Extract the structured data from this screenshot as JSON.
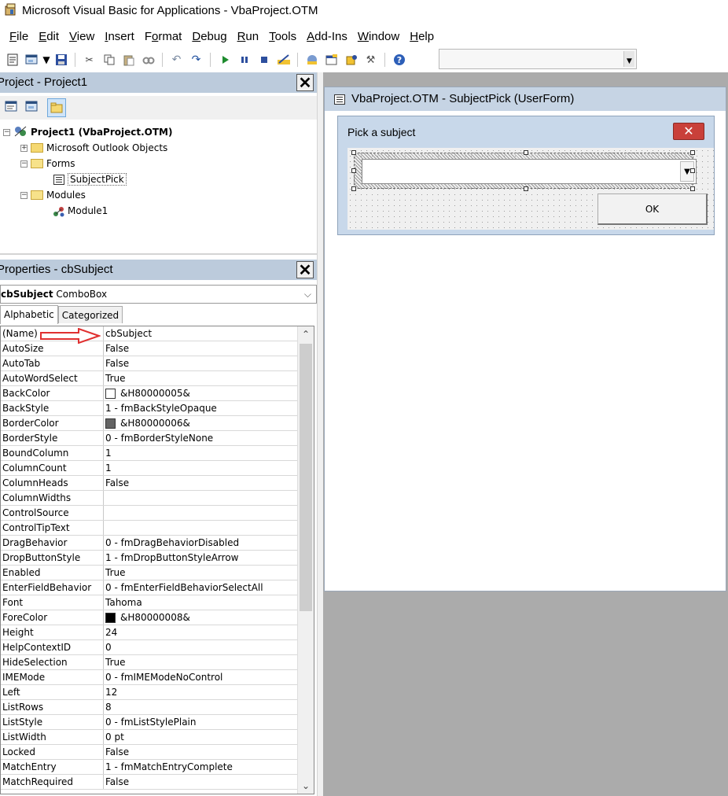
{
  "window": {
    "title": "Microsoft Visual Basic for Applications - VbaProject.OTM"
  },
  "menu": [
    {
      "u": "F",
      "rest": "ile"
    },
    {
      "u": "E",
      "rest": "dit"
    },
    {
      "u": "V",
      "rest": "iew"
    },
    {
      "u": "I",
      "rest": "nsert"
    },
    {
      "pre": "F",
      "u": "o",
      "rest": "rmat"
    },
    {
      "u": "D",
      "rest": "ebug"
    },
    {
      "u": "R",
      "rest": "un"
    },
    {
      "u": "T",
      "rest": "ools"
    },
    {
      "u": "A",
      "rest": "dd-Ins"
    },
    {
      "u": "W",
      "rest": "indow"
    },
    {
      "u": "H",
      "rest": "elp"
    }
  ],
  "toolbar": {
    "icons": [
      "view-excel-icon",
      "insert-userform-icon",
      "save-icon",
      "cut-icon",
      "copy-icon",
      "paste-icon",
      "find-icon",
      "undo-icon",
      "redo-icon",
      "run-icon",
      "break-icon",
      "reset-icon",
      "design-mode-icon",
      "project-explorer-icon",
      "properties-window-icon",
      "object-browser-icon",
      "toolbox-icon",
      "help-icon"
    ]
  },
  "project_pane": {
    "title": "Project - Project1",
    "tree": {
      "root": "Project1 (VbaProject.OTM)",
      "outlook_objects": "Microsoft Outlook Objects",
      "forms": "Forms",
      "form_item": "SubjectPick",
      "modules": "Modules",
      "module_item": "Module1"
    }
  },
  "properties_pane": {
    "title": "Properties - cbSubject",
    "object_name": "cbSubject",
    "object_type": "ComboBox",
    "tabs": [
      "Alphabetic",
      "Categorized"
    ],
    "rows": [
      {
        "name": "(Name)",
        "value": "cbSubject"
      },
      {
        "name": "AutoSize",
        "value": "False"
      },
      {
        "name": "AutoTab",
        "value": "False"
      },
      {
        "name": "AutoWordSelect",
        "value": "True"
      },
      {
        "name": "BackColor",
        "value": "&H80000005&",
        "swatch": "#ffffff"
      },
      {
        "name": "BackStyle",
        "value": "1 - fmBackStyleOpaque"
      },
      {
        "name": "BorderColor",
        "value": "&H80000006&",
        "swatch": "#646464"
      },
      {
        "name": "BorderStyle",
        "value": "0 - fmBorderStyleNone"
      },
      {
        "name": "BoundColumn",
        "value": "1"
      },
      {
        "name": "ColumnCount",
        "value": "1"
      },
      {
        "name": "ColumnHeads",
        "value": "False"
      },
      {
        "name": "ColumnWidths",
        "value": ""
      },
      {
        "name": "ControlSource",
        "value": ""
      },
      {
        "name": "ControlTipText",
        "value": ""
      },
      {
        "name": "DragBehavior",
        "value": "0 - fmDragBehaviorDisabled"
      },
      {
        "name": "DropButtonStyle",
        "value": "1 - fmDropButtonStyleArrow"
      },
      {
        "name": "Enabled",
        "value": "True"
      },
      {
        "name": "EnterFieldBehavior",
        "value": "0 - fmEnterFieldBehaviorSelectAll"
      },
      {
        "name": "Font",
        "value": "Tahoma"
      },
      {
        "name": "ForeColor",
        "value": "&H80000008&",
        "swatch": "#000000"
      },
      {
        "name": "Height",
        "value": "24"
      },
      {
        "name": "HelpContextID",
        "value": "0"
      },
      {
        "name": "HideSelection",
        "value": "True"
      },
      {
        "name": "IMEMode",
        "value": "0 - fmIMEModeNoControl"
      },
      {
        "name": "Left",
        "value": "12"
      },
      {
        "name": "ListRows",
        "value": "8"
      },
      {
        "name": "ListStyle",
        "value": "0 - fmListStylePlain"
      },
      {
        "name": "ListWidth",
        "value": "0 pt"
      },
      {
        "name": "Locked",
        "value": "False"
      },
      {
        "name": "MatchEntry",
        "value": "1 - fmMatchEntryComplete"
      },
      {
        "name": "MatchRequired",
        "value": "False"
      }
    ]
  },
  "designer": {
    "title": "VbaProject.OTM - SubjectPick (UserForm)",
    "form_caption": "Pick a subject",
    "ok_label": "OK"
  },
  "colors": {
    "pane_header": "#bccbdc",
    "designer_header": "#c6d4e4",
    "workspace": "#ababab",
    "close_red": "#c9403a",
    "annotation_arrow": "#e03030"
  }
}
